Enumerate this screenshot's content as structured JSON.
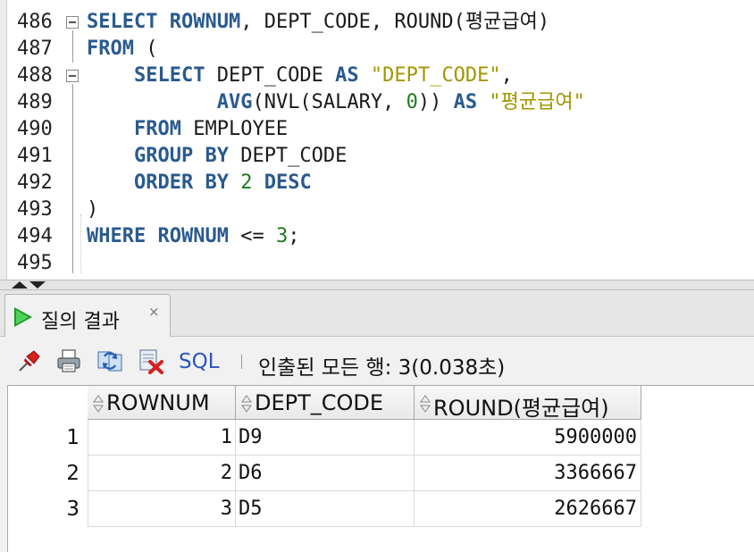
{
  "editor": {
    "lines": [
      {
        "n": "486",
        "segs": [
          [
            "kw",
            "SELECT "
          ],
          [
            "kw",
            "ROWNUM"
          ],
          [
            "plain",
            ", DEPT_CODE, ROUND("
          ],
          [
            "kr",
            "평균급여"
          ],
          [
            "plain",
            ")"
          ]
        ]
      },
      {
        "n": "487",
        "segs": [
          [
            "kw",
            "FROM"
          ],
          [
            "plain",
            " ("
          ]
        ]
      },
      {
        "n": "488",
        "segs": [
          [
            "plain",
            "    "
          ],
          [
            "kw",
            "SELECT"
          ],
          [
            "plain",
            " DEPT_CODE "
          ],
          [
            "kw",
            "AS"
          ],
          [
            "plain",
            " "
          ],
          [
            "str",
            "\"DEPT_CODE\""
          ],
          [
            "plain",
            ","
          ]
        ]
      },
      {
        "n": "489",
        "segs": [
          [
            "plain",
            "           "
          ],
          [
            "kw",
            "AVG"
          ],
          [
            "plain",
            "(NVL(SALARY, "
          ],
          [
            "num",
            "0"
          ],
          [
            "plain",
            ")) "
          ],
          [
            "kw",
            "AS"
          ],
          [
            "plain",
            " "
          ],
          [
            "str",
            "\""
          ],
          [
            "strkr",
            "평균급여"
          ],
          [
            "str",
            "\""
          ]
        ]
      },
      {
        "n": "490",
        "segs": [
          [
            "plain",
            "    "
          ],
          [
            "kw",
            "FROM"
          ],
          [
            "plain",
            " EMPLOYEE"
          ]
        ]
      },
      {
        "n": "491",
        "segs": [
          [
            "plain",
            "    "
          ],
          [
            "kw",
            "GROUP BY"
          ],
          [
            "plain",
            " DEPT_CODE"
          ]
        ]
      },
      {
        "n": "492",
        "segs": [
          [
            "plain",
            "    "
          ],
          [
            "kw",
            "ORDER BY"
          ],
          [
            "plain",
            " "
          ],
          [
            "num",
            "2"
          ],
          [
            "plain",
            " "
          ],
          [
            "kw",
            "DESC"
          ]
        ]
      },
      {
        "n": "493",
        "segs": [
          [
            "plain",
            ")"
          ]
        ]
      },
      {
        "n": "494",
        "segs": [
          [
            "kw",
            "WHERE"
          ],
          [
            "plain",
            " "
          ],
          [
            "kw",
            "ROWNUM"
          ],
          [
            "plain",
            " <= "
          ],
          [
            "num",
            "3"
          ],
          [
            "plain",
            ";"
          ]
        ]
      },
      {
        "n": "495",
        "segs": []
      }
    ]
  },
  "result_tab": {
    "label": "질의 결과",
    "close": "×"
  },
  "toolbar": {
    "pin_icon": "pin-icon",
    "print_icon": "print-icon",
    "refresh_icon": "refresh-icon",
    "cancel_icon": "cancel-icon",
    "sql_label": "SQL",
    "status": "인출된 모든 행: 3(0.038초)"
  },
  "grid": {
    "columns": [
      "ROWNUM",
      "DEPT_CODE",
      "ROUND(평균급여)"
    ],
    "rows": [
      {
        "rn": "1",
        "rownum": "1",
        "dept_code": "D9",
        "round": "5900000"
      },
      {
        "rn": "2",
        "rownum": "2",
        "dept_code": "D6",
        "round": "3366667"
      },
      {
        "rn": "3",
        "rownum": "3",
        "dept_code": "D5",
        "round": "2626667"
      }
    ]
  },
  "colors": {
    "keyword": "#2a5a8e",
    "string": "#a39600",
    "number": "#1f7a1f",
    "current_line": "#fdf6e3",
    "sql_link": "#2a56b8"
  }
}
